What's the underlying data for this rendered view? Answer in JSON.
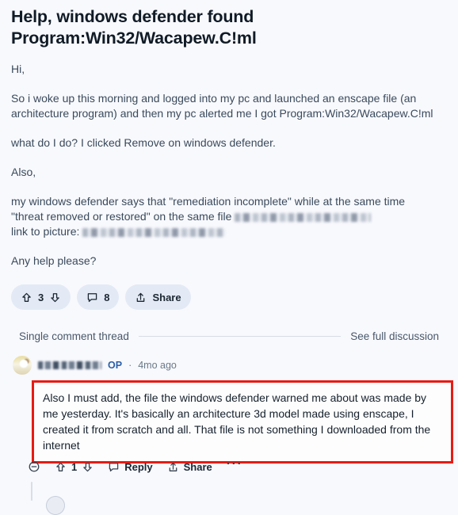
{
  "post": {
    "title": "Help, windows defender found Program:Win32/Wacapew.C!ml",
    "body": {
      "greeting": "Hi,",
      "para1": "So i woke up this morning and logged into my pc and launched an enscape file (an architecture program) and then my pc alerted me I got Program:Win32/Wacapew.C!ml",
      "para2": "what do I do? I clicked Remove on windows defender.",
      "para3": "Also,",
      "para4_line1": "my windows defender says that \"remediation incomplete\" while at the same time",
      "para4_line2_prefix": "\"threat removed or restored\" on the same file ",
      "para4_line3_prefix": "link to picture: ",
      "para5": "Any help please?"
    },
    "actions": {
      "upvote_icon": "upvote-arrow-icon",
      "vote_count": "3",
      "downvote_icon": "downvote-arrow-icon",
      "comment_icon": "comment-bubble-icon",
      "comment_count": "8",
      "share_icon": "share-arrow-icon",
      "share_label": "Share"
    }
  },
  "thread_divider": {
    "left_label": "Single comment thread",
    "right_label": "See full discussion"
  },
  "comment": {
    "avatar_icon": "user-avatar",
    "username_redacted": true,
    "op_badge": "OP",
    "separator": "·",
    "timestamp": "4mo ago",
    "text": "Also I must add, the file the windows defender warned me about was made by me yesterday. It's basically an architecture 3d model made using enscape, I created it from scratch and all. That file is not something I downloaded from the internet",
    "highlight_color": "#e81b14",
    "actions": {
      "collapse_icon": "collapse-minus-circle-icon",
      "upvote_icon": "upvote-arrow-icon",
      "vote_count": "1",
      "downvote_icon": "downvote-arrow-icon",
      "reply_icon": "reply-bubble-icon",
      "reply_label": "Reply",
      "share_icon": "share-arrow-icon",
      "share_label": "Share",
      "more_label": "···"
    }
  },
  "theme": {
    "background": "#f8f9fd",
    "title_color": "#101b26",
    "body_color": "#3a4a5c",
    "pill_background": "#e3eaf5",
    "op_color": "#2a5fa8",
    "highlight_red": "#e81b14"
  }
}
